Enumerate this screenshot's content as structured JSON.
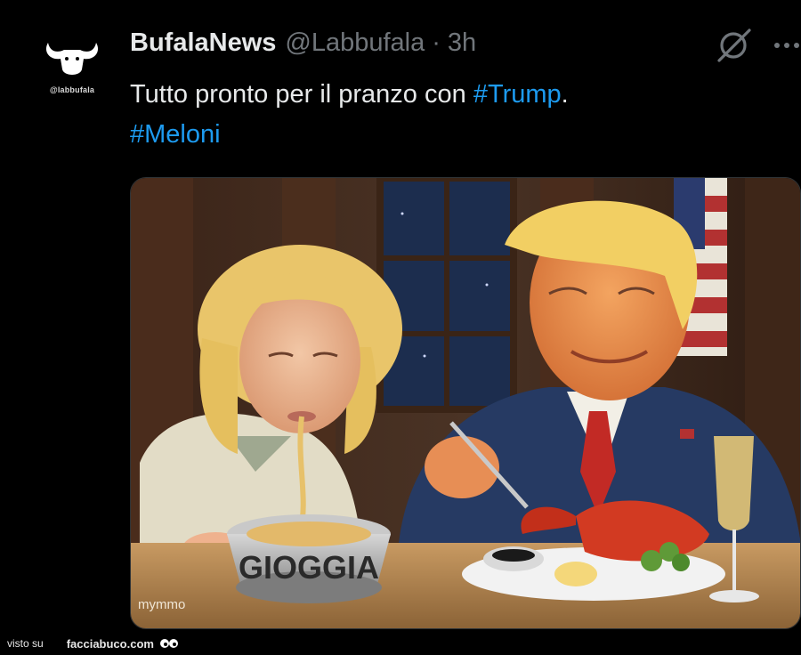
{
  "tweet": {
    "author_name": "BufalaNews",
    "author_handle": "@Labbufala",
    "separator": "·",
    "time": "3h",
    "avatar_caption": "@labbufala",
    "text": "Tutto pronto per il pranzo con ",
    "hashtag_1": "#Trump",
    "after_hashtag_1": ".",
    "hashtag_2": "#Meloni"
  },
  "media": {
    "bowl_label": "GIOGGIA",
    "artist_signature": "mymmo"
  },
  "footer": {
    "prefix": "visto su",
    "site": "facciabuco.com"
  },
  "colors": {
    "background": "#000000",
    "text": "#e7e9ea",
    "muted": "#71767b",
    "link": "#1d9bf0"
  }
}
